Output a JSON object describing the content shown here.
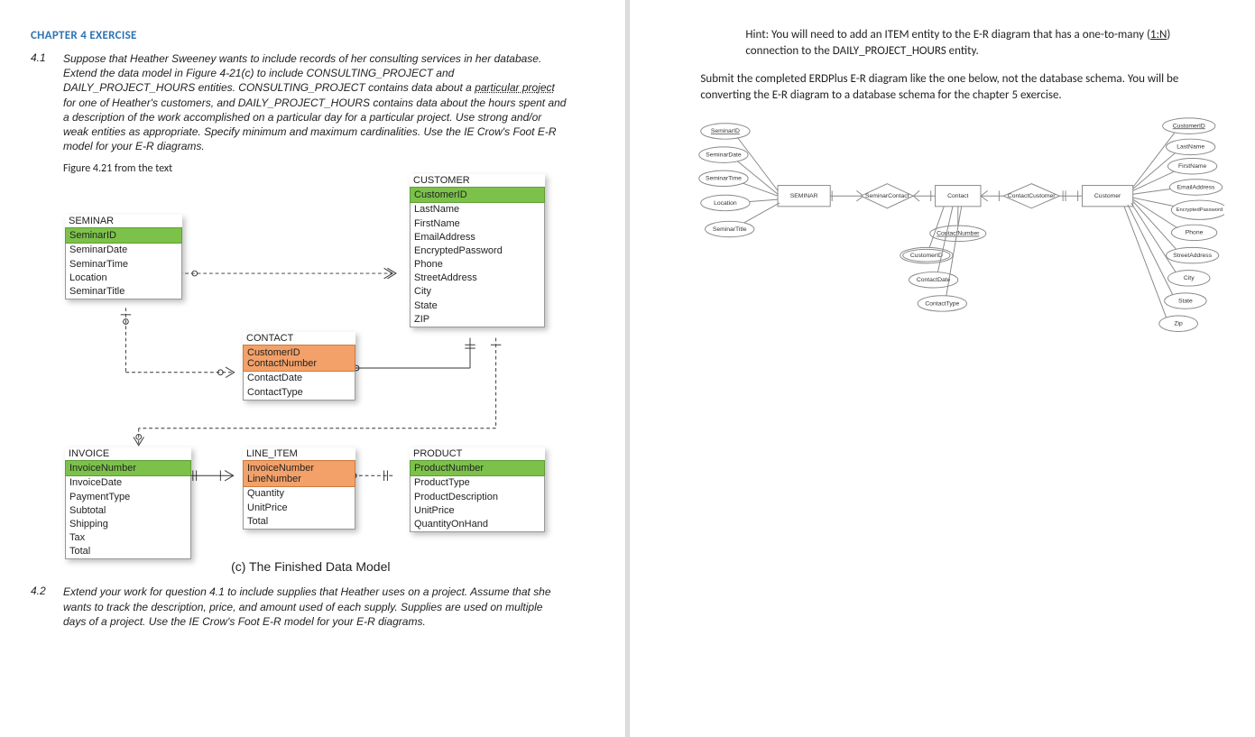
{
  "left": {
    "chapter_title": "CHAPTER 4 EXERCISE",
    "q41_num": "4.1",
    "q41_text_pre": "Suppose that Heather Sweeney wants to include records of her consulting services in her database.  Extend the data model in Figure 4-21(c) to include CONSULTING_PROJECT and DAILY_PROJECT_HOURS entities. CONSULTING_PROJECT contains data about a ",
    "q41_text_dotted": "particular project",
    "q41_text_post": " for one of Heather's customers, and DAILY_PROJECT_HOURS contains data about the hours spent and a description of the work accomplished on a particular day for a particular project. Use strong and/or weak entities as appropriate.  Specify minimum and maximum cardinalities.  Use the IE Crow's Foot E-R model for your E-R diagrams.",
    "figure_caption": "Figure 4.21 from the text",
    "model_caption": "(c) The Finished Data Model",
    "q42_num": "4.2",
    "q42_text": "Extend your work for question 4.1 to include supplies that Heather uses on a project. Assume that she wants to track the description, price, and amount used of each supply. Supplies are used on multiple days of a project. Use the IE Crow's Foot E-R model for your E-R diagrams."
  },
  "entities": {
    "seminar": {
      "label": "SEMINAR",
      "pk": "SeminarID",
      "attrs": [
        "SeminarDate",
        "SeminarTime",
        "Location",
        "SeminarTitle"
      ]
    },
    "customer": {
      "label": "CUSTOMER",
      "pk": "CustomerID",
      "attrs": [
        "LastName",
        "FirstName",
        "EmailAddress",
        "EncryptedPassword",
        "Phone",
        "StreetAddress",
        "City",
        "State",
        "ZIP"
      ]
    },
    "contact": {
      "label": "CONTACT",
      "pk": "CustomerID\nContactNumber",
      "attrs": [
        "ContactDate",
        "ContactType"
      ]
    },
    "invoice": {
      "label": "INVOICE",
      "pk": "InvoiceNumber",
      "attrs": [
        "InvoiceDate",
        "PaymentType",
        "Subtotal",
        "Shipping",
        "Tax",
        "Total"
      ]
    },
    "lineitem": {
      "label": "LINE_ITEM",
      "pk": "InvoiceNumber\nLineNumber",
      "attrs": [
        "Quantity",
        "UnitPrice",
        "Total"
      ]
    },
    "product": {
      "label": "PRODUCT",
      "pk": "ProductNumber",
      "attrs": [
        "ProductType",
        "ProductDescription",
        "UnitPrice",
        "QuantityOnHand"
      ]
    }
  },
  "right": {
    "hint_pre": "Hint: You will need to add an ITEM entity to the E-R diagram that has a one-to-many (",
    "hint_link": "1:N",
    "hint_post": ") connection to the DAILY_PROJECT_HOURS entity.",
    "submit_text": "Submit the completed ERDPlus E-R diagram like the one below, not the database schema.  You will be converting the E-R diagram to a database schema for the chapter 5 exercise."
  },
  "chen": {
    "entities": [
      "SEMINAR",
      "Contact",
      "Customer"
    ],
    "relationships": [
      "SeminarContact",
      "ContactCustomer"
    ],
    "seminar_attrs": [
      "SeminarID",
      "SeminarDate",
      "SeminarTime",
      "Location",
      "SeminarTitle"
    ],
    "contact_attrs": [
      "ContactNumber",
      "CustomerID",
      "ContactDate",
      "ContactType"
    ],
    "customer_attrs": [
      "CustomerID",
      "LastName",
      "FirstName",
      "EmailAddress",
      "EncryptedPassword",
      "Phone",
      "StreetAddress",
      "City",
      "State",
      "Zip"
    ]
  }
}
